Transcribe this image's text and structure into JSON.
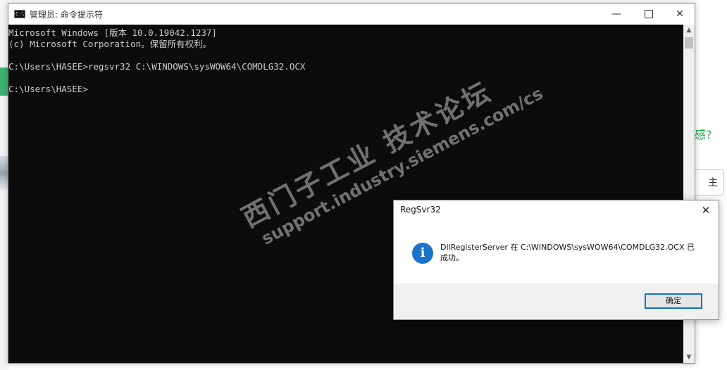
{
  "console": {
    "title": "管理员: 命令提示符",
    "icon_text": "C:\\",
    "lines": [
      "Microsoft Windows [版本 10.0.19042.1237]",
      "(c) Microsoft Corporation。保留所有权利。",
      "",
      "C:\\Users\\HASEE>regsvr32 C:\\WINDOWS\\sysWOW64\\COMDLG32.OCX",
      "",
      "C:\\Users\\HASEE>"
    ]
  },
  "window_controls": {
    "minimize": "—",
    "close": "✕"
  },
  "watermark": {
    "chinese": "西门子工业 技术论坛",
    "url": "support.industry.siemens.com/cs"
  },
  "dialog": {
    "title": "RegSvr32",
    "close": "✕",
    "icon_glyph": "i",
    "message": "DllRegisterServer 在 C:\\WINDOWS\\sysWOW64\\COMDLG32.OCX 已成功。",
    "ok_label": "确定"
  },
  "background": {
    "right_question": "感?",
    "right_box_char": "主"
  },
  "colors": {
    "console_bg": "#0c0c0c",
    "console_text": "#cccccc",
    "info_icon": "#1a73c9",
    "ok_border": "#1170cf"
  }
}
